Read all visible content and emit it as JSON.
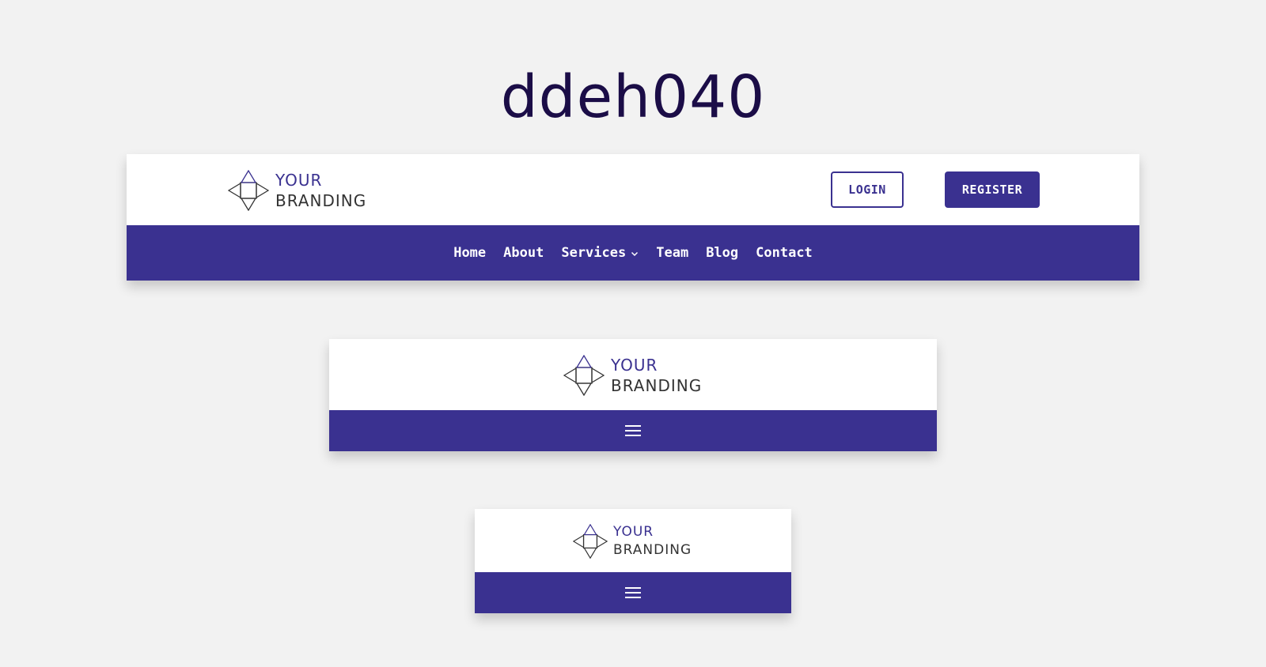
{
  "page": {
    "title": "ddeh040"
  },
  "brand": {
    "line1": "YOUR",
    "line2": "BRANDING",
    "icon": "diamond-logo-icon"
  },
  "header": {
    "login_label": "LOGIN",
    "register_label": "REGISTER"
  },
  "nav": {
    "items": [
      {
        "label": "Home"
      },
      {
        "label": "About"
      },
      {
        "label": "Services",
        "has_dropdown": true
      },
      {
        "label": "Team"
      },
      {
        "label": "Blog"
      },
      {
        "label": "Contact"
      }
    ]
  },
  "colors": {
    "accent": "#3a3190",
    "title": "#1b0d47",
    "background": "#f2f2f2",
    "text_dark": "#333333"
  }
}
